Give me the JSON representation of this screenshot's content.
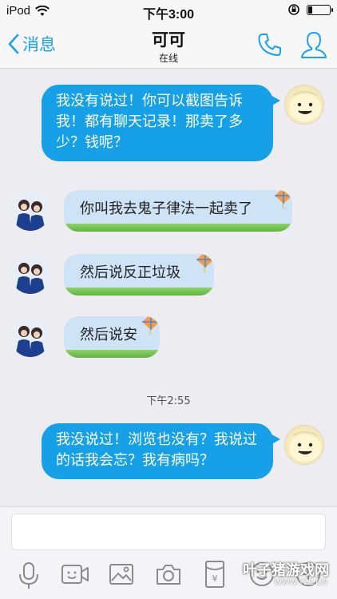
{
  "status_bar": {
    "carrier": "iPod",
    "time": "下午3:00"
  },
  "nav": {
    "back_label": "消息",
    "title": "可可",
    "subtitle": "在线"
  },
  "messages": [
    {
      "side": "out",
      "text": "我没有说过！你可以截图告诉我！都有聊天记录！那卖了多少？钱呢？"
    },
    {
      "side": "in",
      "text": "你叫我去鬼子律法一起卖了"
    },
    {
      "side": "in",
      "text": "然后说反正垃圾"
    },
    {
      "side": "in",
      "text": "然后说安"
    },
    {
      "side": "time",
      "text": "下午2:55"
    },
    {
      "side": "out",
      "text": "我没说过！浏览也没有？我说过的话我会忘？我有病吗？"
    }
  ],
  "input": {
    "value": "",
    "placeholder": ""
  },
  "toolbar": [
    "microphone-icon",
    "video-icon",
    "image-icon",
    "camera-icon",
    "red-packet-icon",
    "emoji-icon",
    "plus-icon"
  ],
  "watermark": {
    "title": "叶子猪游戏网",
    "url": "WWW.YZZ.CN"
  },
  "colors": {
    "accent": "#1ea0f0",
    "bubble_out": "#15a0e8",
    "bubble_in": "#cfe3f7",
    "background": "#ececf1"
  }
}
